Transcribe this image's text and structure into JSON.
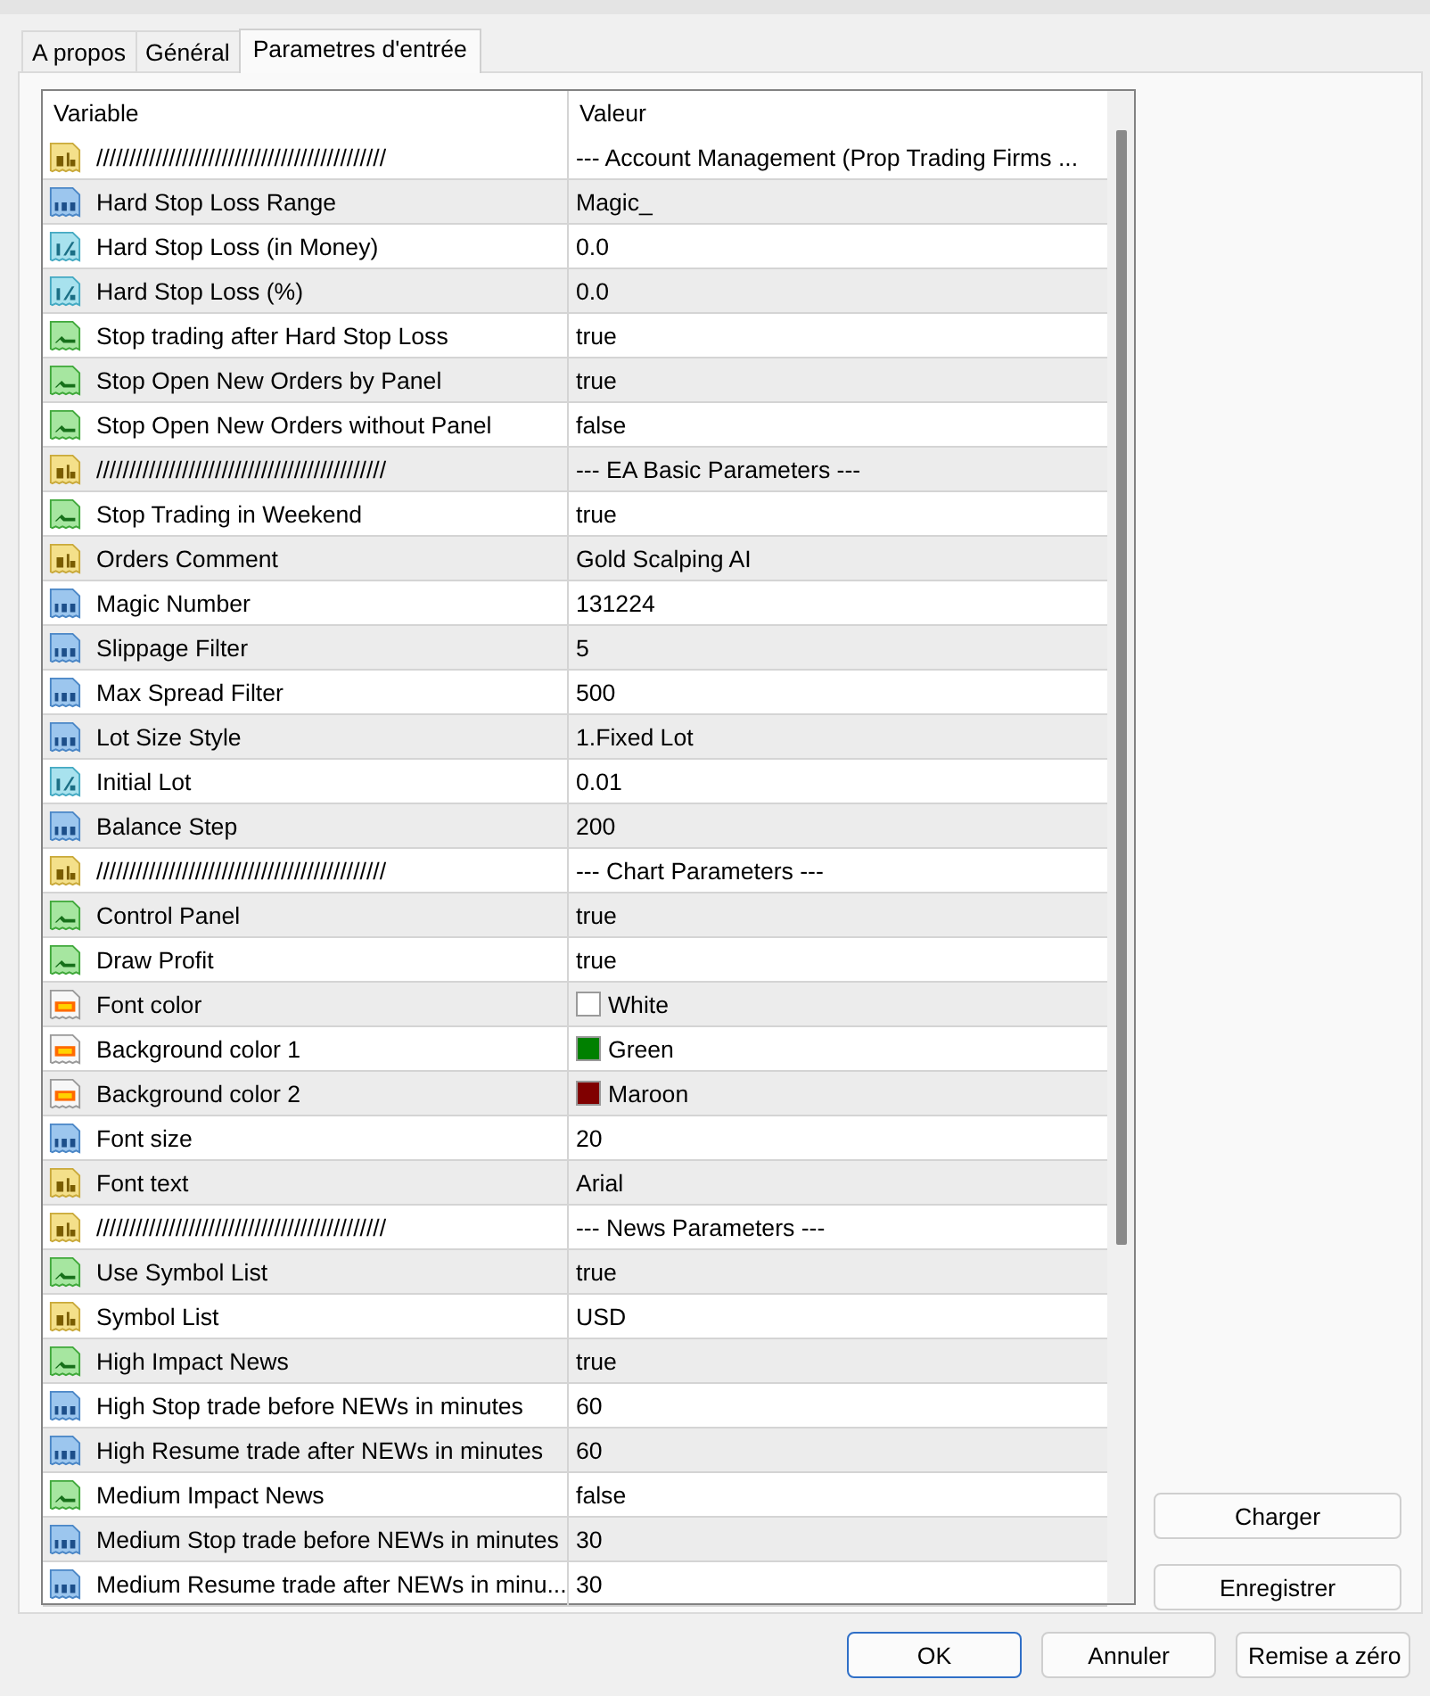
{
  "tabs": [
    {
      "label": "A propos",
      "selected": false
    },
    {
      "label": "Général",
      "selected": false
    },
    {
      "label": "Parametres d'entrée",
      "selected": true
    }
  ],
  "table": {
    "columns": [
      "Variable",
      "Valeur"
    ],
    "rows": [
      {
        "kind": "string",
        "variable": "////////////////////////////////////////////",
        "value": "--- Account Management (Prop Trading Firms ..."
      },
      {
        "kind": "int",
        "variable": "Hard Stop Loss Range",
        "value": "Magic_"
      },
      {
        "kind": "double",
        "variable": "Hard Stop Loss (in Money)",
        "value": "0.0"
      },
      {
        "kind": "double",
        "variable": "Hard Stop Loss (%)",
        "value": "0.0"
      },
      {
        "kind": "bool",
        "variable": "Stop trading after Hard Stop Loss",
        "value": "true"
      },
      {
        "kind": "bool",
        "variable": "Stop Open New Orders by Panel",
        "value": "true"
      },
      {
        "kind": "bool",
        "variable": "Stop Open New Orders without Panel",
        "value": "false"
      },
      {
        "kind": "string",
        "variable": "////////////////////////////////////////////",
        "value": "--- EA Basic Parameters ---"
      },
      {
        "kind": "bool",
        "variable": "Stop Trading in Weekend",
        "value": "true"
      },
      {
        "kind": "string",
        "variable": "Orders Comment",
        "value": "Gold Scalping AI"
      },
      {
        "kind": "int",
        "variable": "Magic Number",
        "value": "131224"
      },
      {
        "kind": "int",
        "variable": "Slippage Filter",
        "value": "5"
      },
      {
        "kind": "int",
        "variable": "Max Spread Filter",
        "value": "500"
      },
      {
        "kind": "int",
        "variable": "Lot Size Style",
        "value": "1.Fixed Lot"
      },
      {
        "kind": "double",
        "variable": "Initial Lot",
        "value": "0.01"
      },
      {
        "kind": "int",
        "variable": "Balance Step",
        "value": "200"
      },
      {
        "kind": "string",
        "variable": "////////////////////////////////////////////",
        "value": "--- Chart Parameters ---"
      },
      {
        "kind": "bool",
        "variable": "Control Panel",
        "value": "true"
      },
      {
        "kind": "bool",
        "variable": "Draw Profit",
        "value": "true"
      },
      {
        "kind": "color",
        "variable": "Font color",
        "value": "White",
        "color": "#ffffff"
      },
      {
        "kind": "color",
        "variable": "Background color 1",
        "value": "Green",
        "color": "#008000"
      },
      {
        "kind": "color",
        "variable": "Background color 2",
        "value": "Maroon",
        "color": "#800000"
      },
      {
        "kind": "int",
        "variable": "Font size",
        "value": "20"
      },
      {
        "kind": "string",
        "variable": "Font text",
        "value": "Arial"
      },
      {
        "kind": "string",
        "variable": "////////////////////////////////////////////",
        "value": "--- News Parameters ---"
      },
      {
        "kind": "bool",
        "variable": "Use Symbol List",
        "value": "true"
      },
      {
        "kind": "string",
        "variable": "Symbol List",
        "value": "USD"
      },
      {
        "kind": "bool",
        "variable": "High Impact News",
        "value": "true"
      },
      {
        "kind": "int",
        "variable": "High Stop trade before NEWs in minutes",
        "value": "60"
      },
      {
        "kind": "int",
        "variable": "High Resume trade after NEWs in minutes",
        "value": "60"
      },
      {
        "kind": "bool",
        "variable": "Medium Impact News",
        "value": "false"
      },
      {
        "kind": "int",
        "variable": "Medium Stop trade before NEWs in minutes",
        "value": "30"
      },
      {
        "kind": "int",
        "variable": "Medium Resume trade after NEWs in minu...",
        "value": "30"
      }
    ]
  },
  "side_buttons": [
    "Charger",
    "Enregistrer"
  ],
  "buttons": [
    {
      "label": "OK",
      "default": true
    },
    {
      "label": "Annuler",
      "default": false
    },
    {
      "label": "Remise a zéro",
      "default": false
    }
  ]
}
